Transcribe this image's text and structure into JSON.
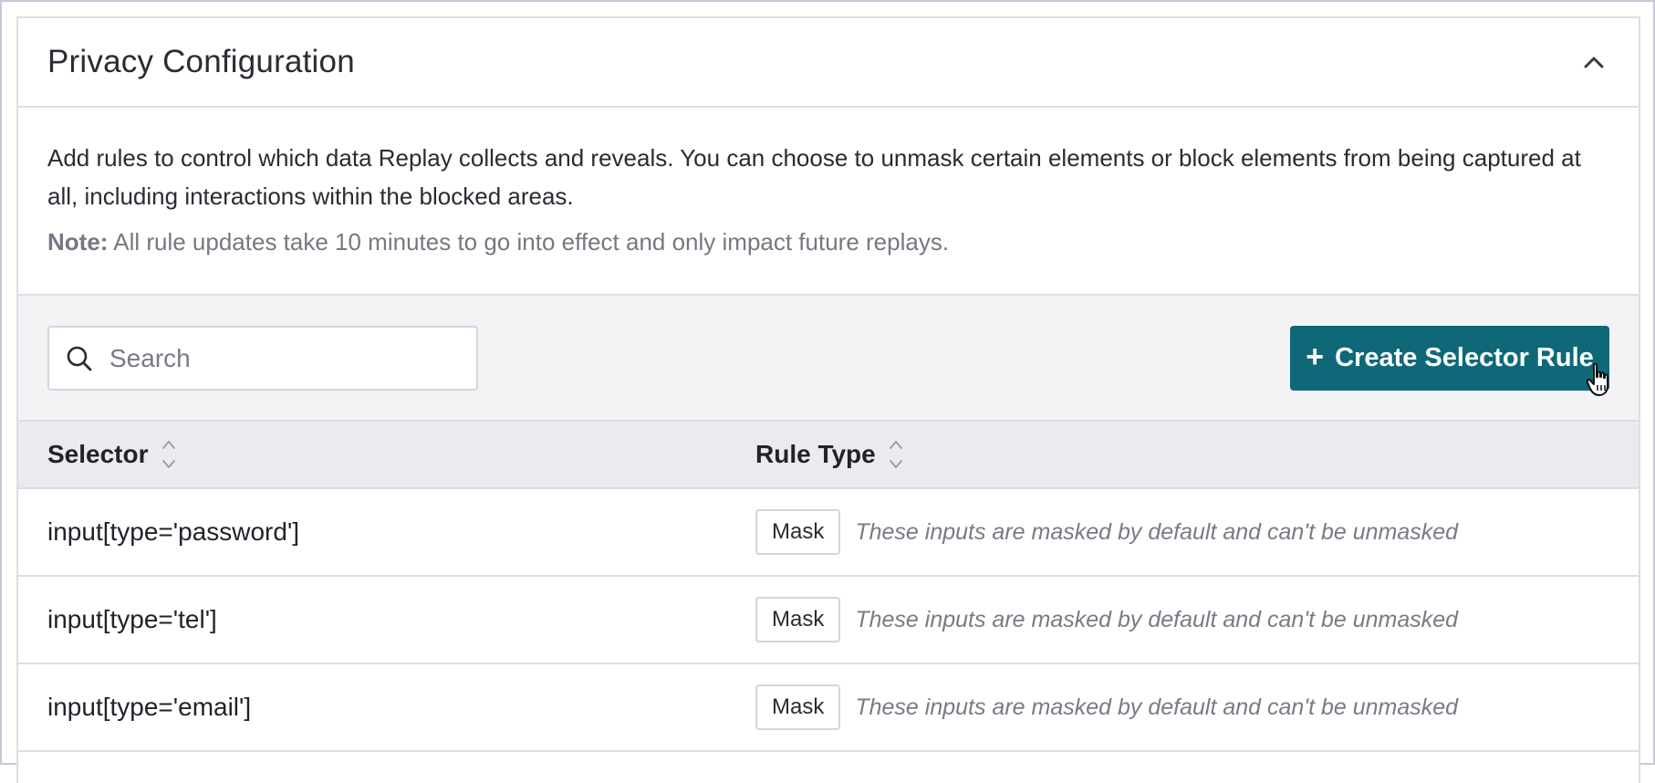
{
  "panel": {
    "title": "Privacy Configuration",
    "collapse_icon": "chevron-up-icon"
  },
  "description": {
    "text": "Add rules to control which data Replay collects and reveals. You can choose to unmask certain elements or block elements from being captured at all, including interactions within the blocked areas.",
    "note_label": "Note:",
    "note_text": " All rule updates take 10 minutes to go into effect and only impact future replays."
  },
  "toolbar": {
    "search_placeholder": "Search",
    "search_value": "",
    "create_button_label": "Create Selector Rule",
    "create_button_icon": "plus-icon",
    "accent_color": "#0e6878"
  },
  "table": {
    "columns": [
      {
        "label": "Selector"
      },
      {
        "label": "Rule Type"
      }
    ],
    "rows": [
      {
        "selector": "input[type='password']",
        "rule_type": "Mask",
        "note": "These inputs are masked by default and can't be unmasked"
      },
      {
        "selector": "input[type='tel']",
        "rule_type": "Mask",
        "note": "These inputs are masked by default and can't be unmasked"
      },
      {
        "selector": "input[type='email']",
        "rule_type": "Mask",
        "note": "These inputs are masked by default and can't be unmasked"
      }
    ]
  }
}
